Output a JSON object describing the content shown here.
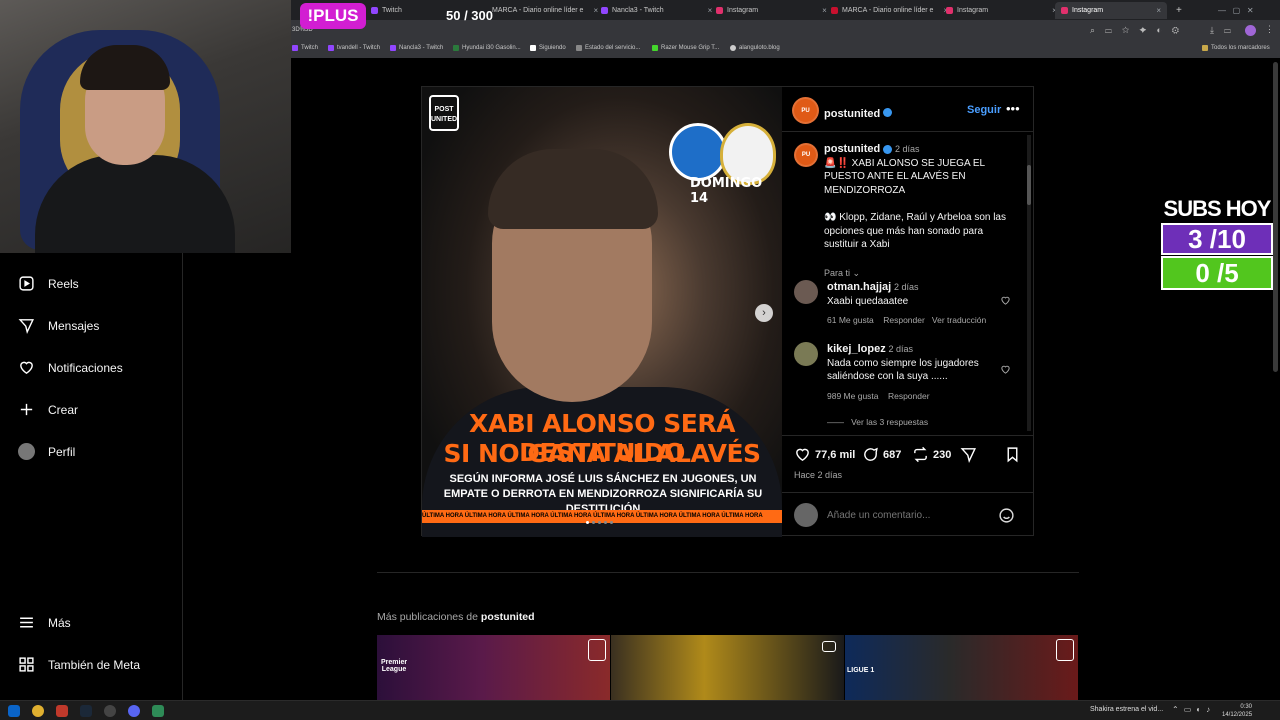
{
  "overlay": {
    "plus_label": "!PLUS",
    "counter": "50 / 300",
    "subs_title": "SUBS HOY",
    "subs_a": "3 /10",
    "subs_b": "0 /5"
  },
  "browser": {
    "tabs": [
      {
        "label": "Twitch",
        "color": "#9146ff"
      },
      {
        "label": "MARCA - Diario online líder e",
        "color": "#c8102e"
      },
      {
        "label": "Nancla3 - Twitch",
        "color": "#9146ff"
      },
      {
        "label": "Instagram",
        "color": "#e1306c"
      },
      {
        "label": "MARCA - Diario online líder e",
        "color": "#c8102e"
      },
      {
        "label": "Instagram",
        "color": "#e1306c"
      },
      {
        "label": "Instagram",
        "color": "#e1306c",
        "active": true
      }
    ],
    "new_tab": "+",
    "address_fragment": "3D%3D",
    "bookmarks": [
      {
        "label": "Twitch",
        "color": "#9146ff"
      },
      {
        "label": "tvandell - Twitch",
        "color": "#9146ff"
      },
      {
        "label": "Nancla3 - Twitch",
        "color": "#9146ff"
      },
      {
        "label": "Hyundai i30 Gasolin...",
        "color": "#2b7a3c"
      },
      {
        "label": "Siguiendo",
        "color": "#ffffff"
      },
      {
        "label": "Estado del servicio...",
        "color": "#888888"
      },
      {
        "label": "Razer Mouse Grip T...",
        "color": "#44d62c"
      },
      {
        "label": "alanguloto.blog",
        "color": "#cccccc"
      }
    ],
    "all_bookmarks": "Todos los marcadores"
  },
  "sidebar": {
    "items": [
      {
        "label": "Reels",
        "icon": "reels-icon"
      },
      {
        "label": "Mensajes",
        "icon": "messages-icon"
      },
      {
        "label": "Notificaciones",
        "icon": "heart-icon"
      },
      {
        "label": "Crear",
        "icon": "plus-icon"
      },
      {
        "label": "Perfil",
        "icon": "avatar"
      }
    ],
    "more": "Más",
    "meta": "También de Meta"
  },
  "post": {
    "image": {
      "brand": "POST UNITED",
      "matchday": "DOMINGO 14",
      "headline_line1": "XABI ALONSO SERÁ DESTITUIDO",
      "headline_line2": "SI NO GANA AL ALAVÉS",
      "subhead": "SEGÚN INFORMA JOSÉ LUIS SÁNCHEZ EN JUGONES, UN EMPATE O DERROTA EN MENDIZORROZA SIGNIFICARÍA SU DESTITUCIÓN",
      "ticker": "ÚLTIMA HORA   ÚLTIMA HORA   ÚLTIMA HORA   ÚLTIMA HORA   ÚLTIMA HORA   ÚLTIMA HORA   ÚLTIMA HORA   ÚLTIMA HORA"
    },
    "author": "postunited",
    "follow": "Seguir",
    "caption": {
      "user": "postunited",
      "time": "2 días",
      "line1": "🚨‼️ XABI ALONSO SE JUEGA EL PUESTO ANTE EL ALAVÉS EN MENDIZORROZA",
      "line2": "👀 Klopp, Zidane, Raúl y Arbeloa son las opciones que más han sonado para sustituir a Xabi",
      "translate": "Para ti"
    },
    "comments": [
      {
        "user": "otman.hajjaj",
        "time": "2 días",
        "text": "Xaabi quedaaatee",
        "likes": "61 Me gusta",
        "reply": "Responder",
        "translate": "Ver traducción"
      },
      {
        "user": "kikej_lopez",
        "time": "2 días",
        "text": "Nada como siempre los jugadores saliéndose con la suya ......",
        "likes": "989 Me gusta",
        "reply": "Responder"
      }
    ],
    "view_replies": "Ver las 3 respuestas",
    "likes": "77,6 mil",
    "comment_count": "687",
    "reposts": "230",
    "time_ago": "Hace 2 días",
    "add_comment_placeholder": "Añade un comentario..."
  },
  "more_posts": {
    "prefix": "Más publicaciones de",
    "user": "postunited",
    "thumbs": [
      {
        "label": "Premier League"
      },
      {
        "label": ""
      },
      {
        "label": "LIGUE 1"
      }
    ]
  },
  "taskbar": {
    "news": "Shakira estrena el vid...",
    "time": "0:30",
    "date": "14/12/2025"
  }
}
